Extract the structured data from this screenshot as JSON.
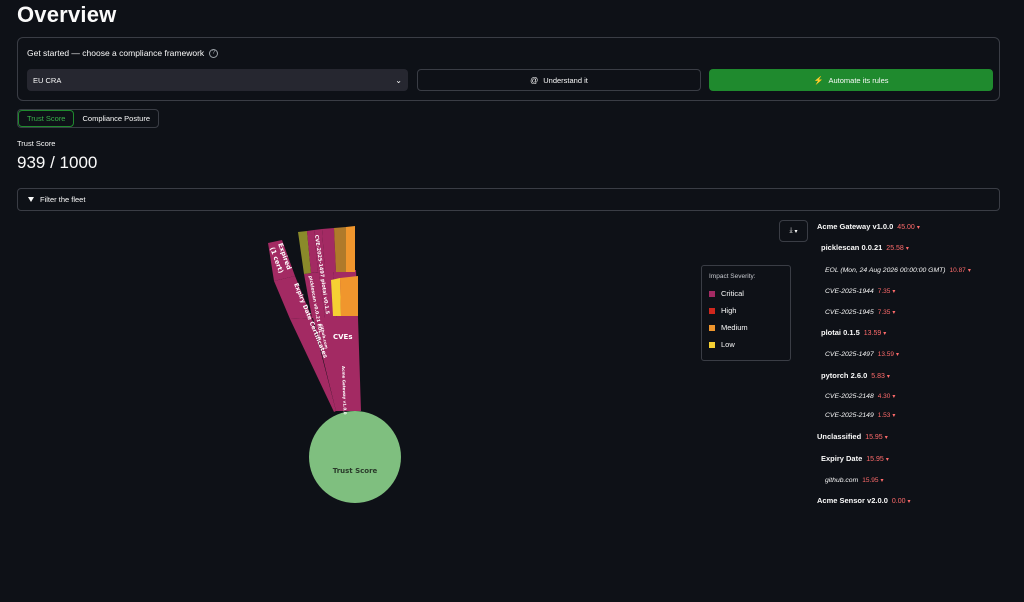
{
  "page": {
    "title": "Overview"
  },
  "framework": {
    "heading": "Get started — choose a compliance framework",
    "help_icon": "question-circle-icon",
    "selected": "EU CRA",
    "understand_label": "Understand it",
    "automate_label": "Automate its rules"
  },
  "tabs": [
    {
      "label": "Trust Score",
      "active": true
    },
    {
      "label": "Compliance Posture",
      "active": false
    }
  ],
  "trust": {
    "label": "Trust Score",
    "value": "939 / 1000"
  },
  "filter": {
    "label": "Filter the fleet"
  },
  "sunburst": {
    "center_label": "Trust Score",
    "labels": {
      "expired": "Expired",
      "expired_count": "(1 cert)",
      "expiry_date_certs": "Expiry Date Certificates",
      "cves": "CVEs",
      "cve_plotai": "CVE-2025-1497 plotai v0.1.5",
      "picklescan_eol": "picklescan v0.0.21 EOL",
      "github_cert": "github.com",
      "acme_gateway": "Acme Gateway v1.0.0"
    }
  },
  "legend": {
    "title": "Impact Severity:",
    "items": [
      {
        "label": "Critical",
        "color": "#a32a63"
      },
      {
        "label": "High",
        "color": "#d0271d"
      },
      {
        "label": "Medium",
        "color": "#f0962d"
      },
      {
        "label": "Low",
        "color": "#f5d033"
      }
    ]
  },
  "download": {
    "icon": "download-icon"
  },
  "tree": [
    {
      "name": "Acme Gateway v1.0.0",
      "value": "45.00",
      "level": 0
    },
    {
      "name": "picklescan 0.0.21",
      "value": "25.58",
      "level": 1
    },
    {
      "name": "EOL (Mon, 24 Aug 2026 00:00:00 GMT)",
      "value": "10.87",
      "level": 2
    },
    {
      "name": "CVE-2025-1944",
      "value": "7.35",
      "level": 2
    },
    {
      "name": "CVE-2025-1945",
      "value": "7.35",
      "level": 2
    },
    {
      "name": "plotai 0.1.5",
      "value": "13.59",
      "level": 1
    },
    {
      "name": "CVE-2025-1497",
      "value": "13.59",
      "level": 2
    },
    {
      "name": "pytorch 2.6.0",
      "value": "5.83",
      "level": 1
    },
    {
      "name": "CVE-2025-2148",
      "value": "4.30",
      "level": 2
    },
    {
      "name": "CVE-2025-2149",
      "value": "1.53",
      "level": 2
    },
    {
      "name": "Unclassified",
      "value": "15.95",
      "level": 0
    },
    {
      "name": "Expiry Date",
      "value": "15.95",
      "level": 1
    },
    {
      "name": "github.com",
      "value": "15.95",
      "level": 2
    },
    {
      "name": "Acme Sensor v2.0.0",
      "value": "0.00",
      "level": 0
    }
  ],
  "colors": {
    "accent_green": "#1f8a2e",
    "trust_green": "#7fbf7f",
    "critical": "#a32a63",
    "medium": "#f0962d",
    "low": "#f5d033",
    "value_red": "#ff6b6b"
  }
}
